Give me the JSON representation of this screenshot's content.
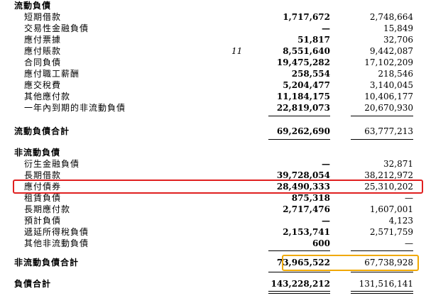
{
  "current_liabilities": {
    "header": "流動負債",
    "rows": [
      {
        "label": "短期借款",
        "note": "",
        "current": "1,717,672",
        "prior": "2,748,664"
      },
      {
        "label": "交易性金融負債",
        "note": "",
        "current": "—",
        "prior": "15,849"
      },
      {
        "label": "應付票據",
        "note": "",
        "current": "51,817",
        "prior": "32,706"
      },
      {
        "label": "應付賬款",
        "note": "11",
        "current": "8,551,640",
        "prior": "9,442,087"
      },
      {
        "label": "合同負債",
        "note": "",
        "current": "19,475,282",
        "prior": "17,102,209"
      },
      {
        "label": "應付職工薪酬",
        "note": "",
        "current": "258,554",
        "prior": "218,546"
      },
      {
        "label": "應交稅費",
        "note": "",
        "current": "5,204,477",
        "prior": "3,140,045"
      },
      {
        "label": "其他應付款",
        "note": "",
        "current": "11,184,175",
        "prior": "10,406,177"
      },
      {
        "label": "一年內到期的非流動負債",
        "note": "",
        "current": "22,819,073",
        "prior": "20,670,930"
      }
    ],
    "total": {
      "label": "流動負債合計",
      "current": "69,262,690",
      "prior": "63,777,213"
    }
  },
  "non_current_liabilities": {
    "header": "非流動負債",
    "rows": [
      {
        "label": "衍生金融負債",
        "note": "",
        "current": "—",
        "prior": "32,871"
      },
      {
        "label": "長期借款",
        "note": "",
        "current": "39,728,054",
        "prior": "38,212,972"
      },
      {
        "label": "應付債券",
        "note": "",
        "current": "28,490,333",
        "prior": "25,310,202"
      },
      {
        "label": "租賃負債",
        "note": "",
        "current": "875,318",
        "prior": "—"
      },
      {
        "label": "長期應付款",
        "note": "",
        "current": "2,717,476",
        "prior": "1,607,001"
      },
      {
        "label": "預計負債",
        "note": "",
        "current": "—",
        "prior": "4,123"
      },
      {
        "label": "遞延所得稅負債",
        "note": "",
        "current": "2,153,741",
        "prior": "2,571,759"
      },
      {
        "label": "其他非流動負債",
        "note": "",
        "current": "600",
        "prior": "—"
      }
    ],
    "total": {
      "label": "非流動負債合計",
      "current": "73,965,522",
      "prior": "67,738,928"
    }
  },
  "grand_total": {
    "label": "負債合計",
    "current": "143,228,212",
    "prior": "131,516,141"
  },
  "highlight_colors": {
    "bonds_box": "#e02020",
    "noncurrent_total_box": "#f0a800"
  }
}
